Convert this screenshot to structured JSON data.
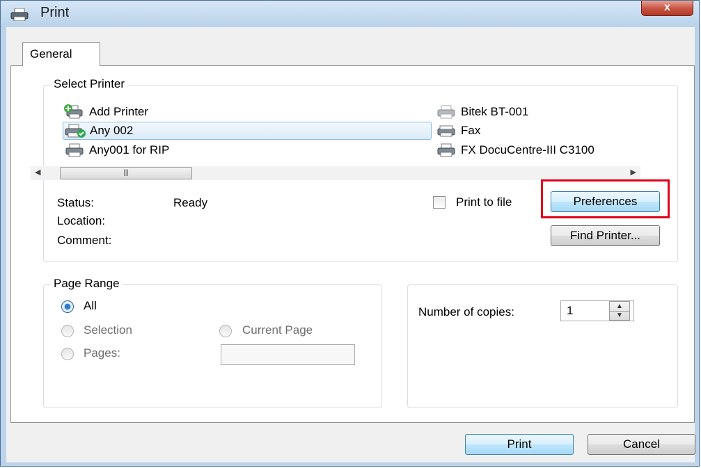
{
  "window": {
    "title": "Print",
    "close_label": "x"
  },
  "tabs": [
    {
      "label": "General"
    }
  ],
  "select_printer": {
    "label": "Select Printer",
    "printers": [
      {
        "name": "Add Printer",
        "icon": "add-printer-icon"
      },
      {
        "name": "Any 002",
        "icon": "default-printer-icon",
        "selected": true,
        "default": true
      },
      {
        "name": "Any001 for RIP",
        "icon": "printer-icon"
      },
      {
        "name": "Bitek BT-001",
        "icon": "printer-icon",
        "offline": true
      },
      {
        "name": "Fax",
        "icon": "fax-icon"
      },
      {
        "name": "FX DocuCentre-III C3100",
        "icon": "printer-icon"
      }
    ],
    "status_label": "Status:",
    "status_value": "Ready",
    "location_label": "Location:",
    "comment_label": "Comment:",
    "print_to_file_label": "Print to file",
    "print_to_file_checked": false,
    "preferences_label": "Preferences",
    "find_printer_label": "Find Printer..."
  },
  "page_range": {
    "label": "Page Range",
    "all_label": "All",
    "selection_label": "Selection",
    "current_page_label": "Current Page",
    "pages_label": "Pages:",
    "pages_value": "",
    "selected": "All"
  },
  "copies": {
    "label": "Number of copies:",
    "value": "1"
  },
  "buttons": {
    "print": "Print",
    "cancel": "Cancel"
  },
  "colors": {
    "highlight_box": "#e0001a",
    "focus_border": "#3c7fb1",
    "title_bar": "#c7dcf0"
  }
}
